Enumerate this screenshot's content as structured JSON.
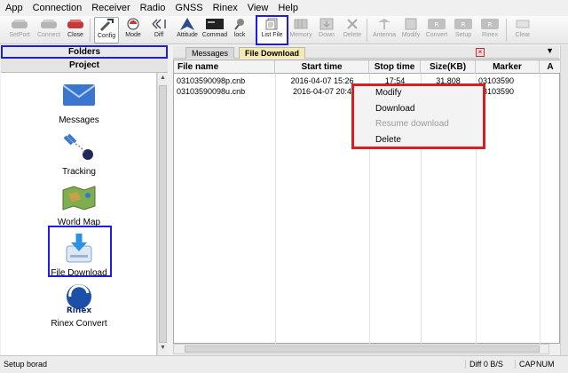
{
  "menu": [
    "App",
    "Connection",
    "Receiver",
    "Radio",
    "GNSS",
    "Rinex",
    "View",
    "Help"
  ],
  "toolbar": [
    {
      "label": "SetPort",
      "icon": "port-icon",
      "disabled": true
    },
    {
      "label": "Connect",
      "icon": "connect-icon",
      "disabled": true
    },
    {
      "label": "Close",
      "icon": "close-port-icon",
      "disabled": false
    },
    {
      "label": "Config",
      "icon": "config-tools-icon",
      "disabled": false
    },
    {
      "label": "Mode",
      "icon": "mode-icon",
      "disabled": false
    },
    {
      "label": "Diff",
      "icon": "diff-icon",
      "disabled": false
    },
    {
      "label": "Attitude",
      "icon": "attitude-icon",
      "disabled": false
    },
    {
      "label": "Commad",
      "icon": "command-icon",
      "disabled": false
    },
    {
      "label": "lock",
      "icon": "lock-icon",
      "disabled": false
    },
    {
      "label": "List File",
      "icon": "list-file-icon",
      "disabled": false
    },
    {
      "label": "Memory",
      "icon": "memory-icon",
      "disabled": true
    },
    {
      "label": "Down",
      "icon": "down-icon",
      "disabled": true
    },
    {
      "label": "Delete",
      "icon": "delete-x-icon",
      "disabled": true
    },
    {
      "label": "Antenna",
      "icon": "antenna-icon",
      "disabled": true
    },
    {
      "label": "Modify",
      "icon": "modify-icon",
      "disabled": true
    },
    {
      "label": "Convert",
      "icon": "rinex-convert-icon",
      "disabled": true
    },
    {
      "label": "Setup",
      "icon": "rinex-setup-icon",
      "disabled": true
    },
    {
      "label": "Rinex",
      "icon": "rinex-icon",
      "disabled": true
    },
    {
      "label": "Clear",
      "icon": "clear-icon",
      "disabled": true
    }
  ],
  "left": {
    "folders": "Folders",
    "project": "Project",
    "items": [
      {
        "label": "Messages",
        "icon": "envelope-icon"
      },
      {
        "label": "Tracking",
        "icon": "satellite-icon"
      },
      {
        "label": "World Map",
        "icon": "world-map-icon"
      },
      {
        "label": "File Download",
        "icon": "file-download-icon"
      },
      {
        "label": "Rinex Convert",
        "icon": "rinex-logo-icon"
      }
    ]
  },
  "tabs": [
    {
      "label": "Messages",
      "active": false
    },
    {
      "label": "File Download",
      "active": true
    }
  ],
  "table": {
    "columns": [
      "File name",
      "Start time",
      "Stop time",
      "Size(KB)",
      "Marker",
      "A"
    ],
    "rows": [
      {
        "name": "03103590098p.cnb",
        "start": "2016-04-07 15:26",
        "stop": "17:54",
        "size": "31,808",
        "marker": "03103590"
      },
      {
        "name": "03103590098u.cnb",
        "start": "2016-04-07 20:4",
        "stop": "",
        "size": "",
        "marker": "03103590"
      }
    ]
  },
  "context_menu": [
    {
      "label": "Modify",
      "disabled": false
    },
    {
      "label": "Download",
      "disabled": false
    },
    {
      "label": "Resume download",
      "disabled": true
    },
    {
      "label": "Delete",
      "disabled": false
    }
  ],
  "status": {
    "left": "Setup borad",
    "diff": "Diff 0 B/S",
    "caps": "CAP",
    "num": "NUM"
  }
}
